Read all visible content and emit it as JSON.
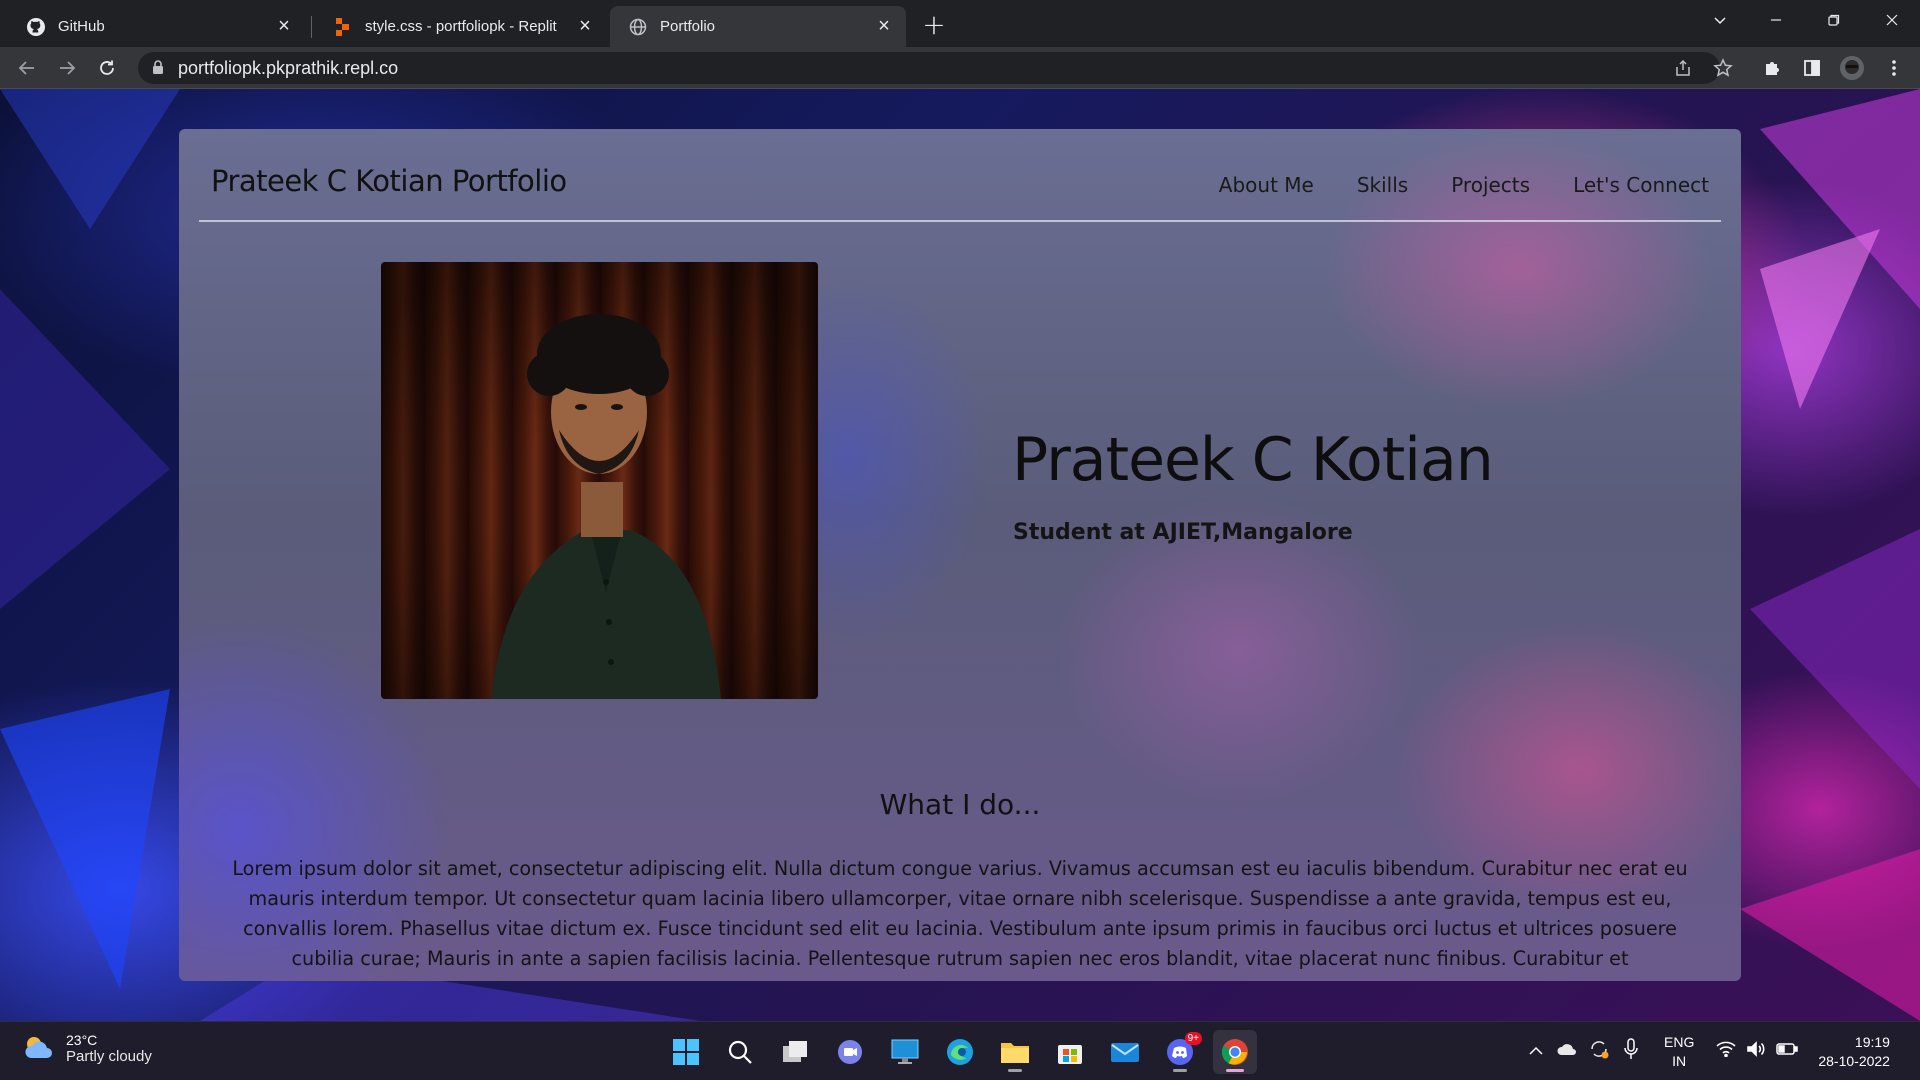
{
  "browser": {
    "tabs": [
      {
        "title": "GitHub",
        "icon": "github-icon",
        "active": false
      },
      {
        "title": "style.css - portfoliopk - Replit",
        "icon": "replit-icon",
        "active": false
      },
      {
        "title": "Portfolio",
        "icon": "globe-icon",
        "active": true
      }
    ],
    "url": "portfoliopk.pkprathik.repl.co"
  },
  "page": {
    "brand": "Prateek C Kotian Portfolio",
    "nav": [
      "About Me",
      "Skills",
      "Projects",
      "Let's Connect"
    ],
    "hero": {
      "name": "Prateek C Kotian",
      "subtitle": "Student at AJIET,Mangalore"
    },
    "section_title": "What I do...",
    "section_text": "Lorem ipsum dolor sit amet, consectetur adipiscing elit. Nulla dictum congue varius. Vivamus accumsan est eu iaculis bibendum. Curabitur nec erat eu mauris interdum tempor. Ut consectetur quam lacinia libero ullamcorper, vitae ornare nibh scelerisque. Suspendisse a ante gravida, tempus est eu, convallis lorem. Phasellus vitae dictum ex. Fusce tincidunt sed elit eu lacinia. Vestibulum ante ipsum primis in faucibus orci luctus et ultrices posuere cubilia curae; Mauris in ante a sapien facilisis lacinia. Pellentesque rutrum sapien nec eros blandit, vitae placerat nunc finibus. Curabitur et"
  },
  "taskbar": {
    "weather": {
      "temp": "23°C",
      "condition": "Partly cloudy"
    },
    "apps": [
      "start-icon",
      "search-icon",
      "task-view-icon",
      "chat-icon",
      "desktop-app-icon",
      "edge-icon",
      "file-explorer-icon",
      "store-icon",
      "mail-icon",
      "discord-icon",
      "chrome-icon"
    ],
    "discord_badge": "9+",
    "language": "ENG",
    "region": "IN",
    "time": "19:19",
    "date": "28-10-2022"
  },
  "colors": {
    "chrome_dark": "#202124",
    "chrome_toolbar": "#35363a",
    "taskbar": "#1f1d2b",
    "text_dark": "#111111"
  }
}
